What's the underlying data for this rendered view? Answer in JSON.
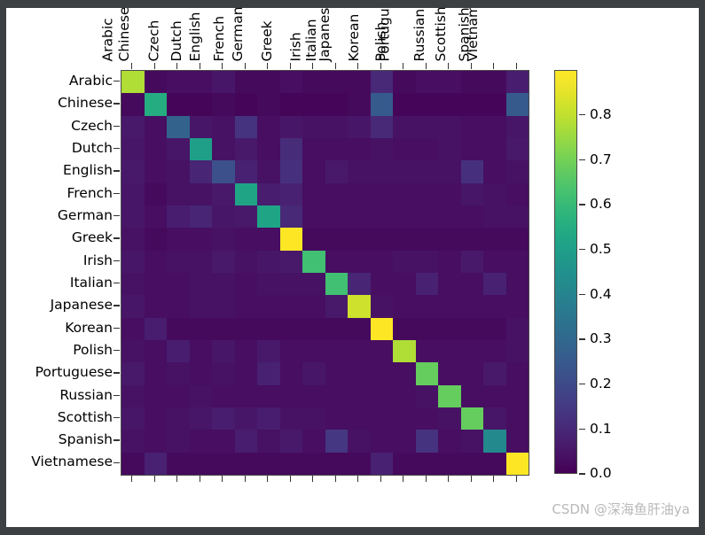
{
  "figure": {
    "background": "#ffffff",
    "frame_color": "#3c4043",
    "axis_color": "#4a4a4a"
  },
  "watermark": {
    "text": "CSDN @深海鱼肝油ya",
    "color": "#b9b9b9"
  },
  "colorbar": {
    "ticks": [
      "0.0",
      "0.1",
      "0.2",
      "0.3",
      "0.4",
      "0.5",
      "0.6",
      "0.7",
      "0.8"
    ],
    "tick_values": [
      0.0,
      0.1,
      0.2,
      0.3,
      0.4,
      0.5,
      0.6,
      0.7,
      0.8
    ],
    "vmin": 0.0,
    "vmax": 0.9,
    "colormap": "viridis",
    "orientation": "vertical"
  },
  "chart_data": {
    "type": "heatmap",
    "title": "",
    "xlabel": "",
    "ylabel": "",
    "colormap": "viridis",
    "vmin": 0.0,
    "vmax": 0.9,
    "x_categories": [
      "Arabic",
      "Chinese",
      "Czech",
      "Dutch",
      "English",
      "French",
      "German",
      "Greek",
      "Irish",
      "Italian",
      "Japanese",
      "Korean",
      "Polish",
      "Portuguese",
      "Russian",
      "Scottish",
      "Spanish",
      "Vietnamese"
    ],
    "y_categories": [
      "Arabic",
      "Chinese",
      "Czech",
      "Dutch",
      "English",
      "French",
      "German",
      "Greek",
      "Irish",
      "Italian",
      "Japanese",
      "Korean",
      "Polish",
      "Portuguese",
      "Russian",
      "Scottish",
      "Spanish",
      "Vietnamese"
    ],
    "grid": false,
    "legend_position": "right",
    "values": [
      [
        0.78,
        0.02,
        0.03,
        0.03,
        0.05,
        0.02,
        0.02,
        0.03,
        0.02,
        0.02,
        0.02,
        0.1,
        0.02,
        0.03,
        0.03,
        0.02,
        0.02,
        0.07
      ],
      [
        0.02,
        0.55,
        0.01,
        0.01,
        0.02,
        0.01,
        0.02,
        0.01,
        0.01,
        0.01,
        0.02,
        0.25,
        0.01,
        0.01,
        0.01,
        0.01,
        0.01,
        0.25
      ],
      [
        0.06,
        0.03,
        0.28,
        0.05,
        0.04,
        0.13,
        0.03,
        0.05,
        0.04,
        0.04,
        0.05,
        0.1,
        0.04,
        0.04,
        0.04,
        0.03,
        0.03,
        0.05
      ],
      [
        0.05,
        0.03,
        0.05,
        0.5,
        0.04,
        0.06,
        0.03,
        0.11,
        0.03,
        0.03,
        0.03,
        0.04,
        0.03,
        0.03,
        0.04,
        0.03,
        0.03,
        0.06
      ],
      [
        0.06,
        0.03,
        0.04,
        0.09,
        0.22,
        0.08,
        0.04,
        0.12,
        0.03,
        0.06,
        0.04,
        0.04,
        0.04,
        0.04,
        0.04,
        0.12,
        0.03,
        0.04
      ],
      [
        0.05,
        0.02,
        0.04,
        0.04,
        0.06,
        0.52,
        0.07,
        0.08,
        0.03,
        0.03,
        0.03,
        0.03,
        0.03,
        0.03,
        0.03,
        0.05,
        0.04,
        0.03
      ],
      [
        0.05,
        0.03,
        0.07,
        0.09,
        0.05,
        0.06,
        0.52,
        0.1,
        0.03,
        0.03,
        0.03,
        0.03,
        0.03,
        0.03,
        0.03,
        0.03,
        0.04,
        0.04
      ],
      [
        0.04,
        0.02,
        0.03,
        0.03,
        0.04,
        0.03,
        0.03,
        0.9,
        0.02,
        0.02,
        0.02,
        0.02,
        0.02,
        0.02,
        0.02,
        0.02,
        0.02,
        0.02
      ],
      [
        0.05,
        0.03,
        0.04,
        0.04,
        0.06,
        0.04,
        0.05,
        0.06,
        0.62,
        0.03,
        0.03,
        0.03,
        0.04,
        0.04,
        0.03,
        0.06,
        0.03,
        0.03
      ],
      [
        0.04,
        0.03,
        0.03,
        0.04,
        0.04,
        0.03,
        0.04,
        0.04,
        0.04,
        0.62,
        0.09,
        0.03,
        0.03,
        0.08,
        0.03,
        0.03,
        0.08,
        0.03
      ],
      [
        0.05,
        0.03,
        0.03,
        0.04,
        0.04,
        0.03,
        0.03,
        0.03,
        0.03,
        0.06,
        0.82,
        0.04,
        0.03,
        0.03,
        0.03,
        0.03,
        0.03,
        0.03
      ],
      [
        0.03,
        0.07,
        0.02,
        0.02,
        0.02,
        0.02,
        0.02,
        0.02,
        0.02,
        0.02,
        0.02,
        0.9,
        0.02,
        0.02,
        0.02,
        0.02,
        0.02,
        0.04
      ],
      [
        0.04,
        0.03,
        0.07,
        0.03,
        0.05,
        0.03,
        0.06,
        0.03,
        0.03,
        0.03,
        0.03,
        0.03,
        0.78,
        0.03,
        0.03,
        0.03,
        0.03,
        0.04
      ],
      [
        0.06,
        0.03,
        0.04,
        0.03,
        0.04,
        0.03,
        0.08,
        0.03,
        0.05,
        0.03,
        0.03,
        0.03,
        0.03,
        0.68,
        0.03,
        0.03,
        0.06,
        0.03
      ],
      [
        0.04,
        0.03,
        0.03,
        0.04,
        0.03,
        0.03,
        0.03,
        0.03,
        0.03,
        0.03,
        0.03,
        0.03,
        0.03,
        0.04,
        0.68,
        0.03,
        0.03,
        0.03
      ],
      [
        0.05,
        0.03,
        0.04,
        0.05,
        0.07,
        0.05,
        0.07,
        0.04,
        0.04,
        0.03,
        0.03,
        0.03,
        0.03,
        0.03,
        0.04,
        0.68,
        0.05,
        0.03
      ],
      [
        0.04,
        0.03,
        0.04,
        0.03,
        0.03,
        0.07,
        0.04,
        0.06,
        0.03,
        0.14,
        0.04,
        0.03,
        0.03,
        0.13,
        0.03,
        0.04,
        0.42,
        0.03
      ],
      [
        0.02,
        0.08,
        0.02,
        0.02,
        0.02,
        0.02,
        0.02,
        0.02,
        0.02,
        0.02,
        0.02,
        0.08,
        0.02,
        0.02,
        0.02,
        0.02,
        0.02,
        0.9
      ]
    ]
  }
}
